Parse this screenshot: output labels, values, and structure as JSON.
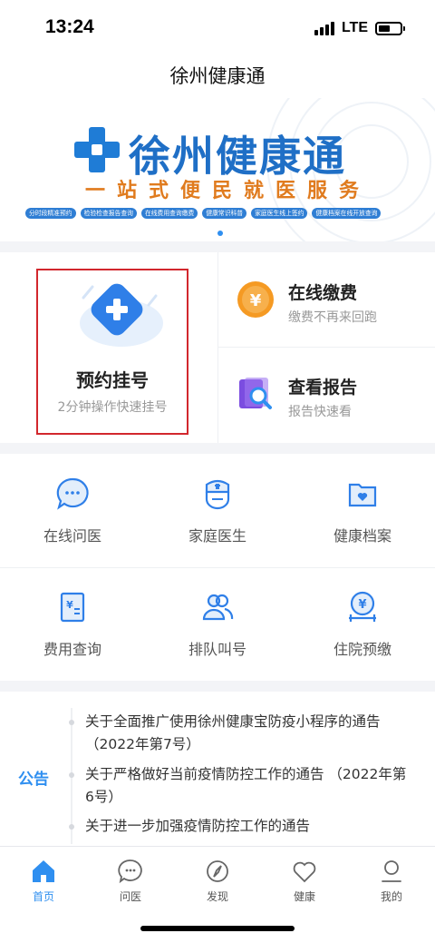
{
  "status_bar": {
    "time": "13:24",
    "network": "LTE"
  },
  "nav": {
    "title": "徐州健康通"
  },
  "banner": {
    "title": "徐州健康通",
    "subtitle": "一站式便民就医服务",
    "tags": [
      "分时段精准预约",
      "检验检查报告查询",
      "在线费用查询缴费",
      "健康常识科普",
      "家庭医生线上签约",
      "健康档案在线开放查询"
    ],
    "accent_color": "#1f6fc6",
    "subtitle_color": "#e07b1e"
  },
  "feature": {
    "booking": {
      "title": "预约挂号",
      "subtitle": "2分钟操作快速挂号",
      "icon": "medical-cross-icon"
    },
    "payment": {
      "title": "在线缴费",
      "subtitle": "缴费不再来回跑",
      "icon": "yuan-coin-icon"
    },
    "report": {
      "title": "查看报告",
      "subtitle": "报告快速看",
      "icon": "report-search-icon"
    }
  },
  "grid": {
    "items": [
      {
        "label": "在线问医",
        "icon": "chat-bubble-icon"
      },
      {
        "label": "家庭医生",
        "icon": "doctor-icon"
      },
      {
        "label": "健康档案",
        "icon": "folder-heart-icon"
      },
      {
        "label": "费用查询",
        "icon": "bill-icon"
      },
      {
        "label": "排队叫号",
        "icon": "queue-people-icon"
      },
      {
        "label": "住院预缴",
        "icon": "hospital-bed-icon"
      }
    ]
  },
  "notice": {
    "label": "公告",
    "items": [
      "关于全面推广使用徐州健康宝防疫小程序的通告 （2022年第7号）",
      "关于严格做好当前疫情防控工作的通告 （2022年第6号）",
      "关于进一步加强疫情防控工作的通告"
    ]
  },
  "tabs": [
    {
      "label": "首页",
      "icon": "home-icon",
      "active": true
    },
    {
      "label": "问医",
      "icon": "chat-icon",
      "active": false
    },
    {
      "label": "发现",
      "icon": "compass-icon",
      "active": false
    },
    {
      "label": "健康",
      "icon": "heart-icon",
      "active": false
    },
    {
      "label": "我的",
      "icon": "user-icon",
      "active": false
    }
  ],
  "colors": {
    "primary": "#2f8ff0",
    "highlight_border": "#d2272d"
  }
}
